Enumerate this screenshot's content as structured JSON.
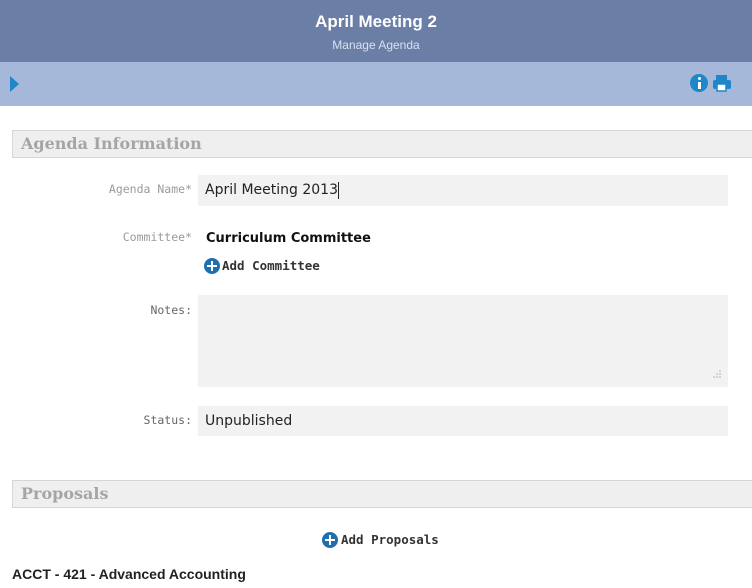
{
  "header": {
    "title": "April Meeting 2",
    "subtitle": "Manage Agenda"
  },
  "toolbar": {
    "left_icon": "play-icon",
    "right_icons": [
      "info-icon",
      "print-icon"
    ],
    "accent": "#1f86c9"
  },
  "agenda_section": {
    "title": "Agenda Information"
  },
  "form": {
    "agenda_name": {
      "label": "Agenda Name*",
      "value": "April Meeting 2013"
    },
    "committee": {
      "label": "Committee*",
      "value": "Curriculum Committee",
      "add_label": "Add Committee"
    },
    "notes": {
      "label": "Notes:",
      "value": ""
    },
    "status": {
      "label": "Status:",
      "value": "Unpublished"
    }
  },
  "proposals_section": {
    "title": "Proposals",
    "add_label": "Add Proposals",
    "items": [
      "ACCT - 421 - Advanced Accounting"
    ]
  },
  "colors": {
    "header_bg": "#6a7ea6",
    "toolbar_bg": "#a6b8d9",
    "section_bg": "#efefef",
    "field_bg": "#f2f2f2"
  }
}
